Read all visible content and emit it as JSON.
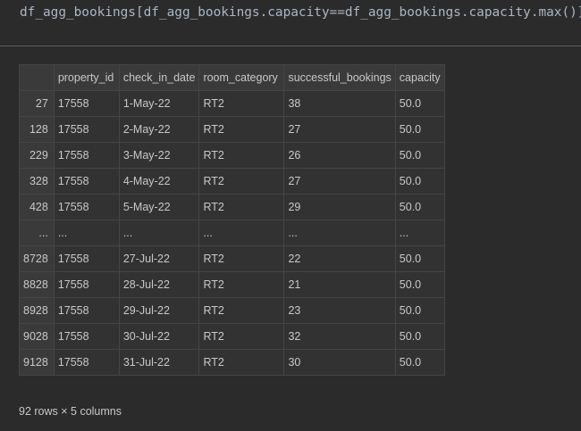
{
  "code_cell": {
    "source": "df_agg_bookings[df_agg_bookings.capacity==df_agg_bookings.capacity.max()]"
  },
  "table": {
    "columns": [
      "",
      "property_id",
      "check_in_date",
      "room_category",
      "successful_bookings",
      "capacity"
    ],
    "rows": [
      {
        "index": "27",
        "cells": [
          "17558",
          "1-May-22",
          "RT2",
          "38",
          "50.0"
        ]
      },
      {
        "index": "128",
        "cells": [
          "17558",
          "2-May-22",
          "RT2",
          "27",
          "50.0"
        ]
      },
      {
        "index": "229",
        "cells": [
          "17558",
          "3-May-22",
          "RT2",
          "26",
          "50.0"
        ]
      },
      {
        "index": "328",
        "cells": [
          "17558",
          "4-May-22",
          "RT2",
          "27",
          "50.0"
        ]
      },
      {
        "index": "428",
        "cells": [
          "17558",
          "5-May-22",
          "RT2",
          "29",
          "50.0"
        ]
      },
      {
        "index": "...",
        "cells": [
          "...",
          "...",
          "...",
          "...",
          "..."
        ]
      },
      {
        "index": "8728",
        "cells": [
          "17558",
          "27-Jul-22",
          "RT2",
          "22",
          "50.0"
        ]
      },
      {
        "index": "8828",
        "cells": [
          "17558",
          "28-Jul-22",
          "RT2",
          "21",
          "50.0"
        ]
      },
      {
        "index": "8928",
        "cells": [
          "17558",
          "29-Jul-22",
          "RT2",
          "23",
          "50.0"
        ]
      },
      {
        "index": "9028",
        "cells": [
          "17558",
          "30-Jul-22",
          "RT2",
          "32",
          "50.0"
        ]
      },
      {
        "index": "9128",
        "cells": [
          "17558",
          "31-Jul-22",
          "RT2",
          "30",
          "50.0"
        ]
      }
    ],
    "shape_text": "92 rows × 5 columns"
  }
}
